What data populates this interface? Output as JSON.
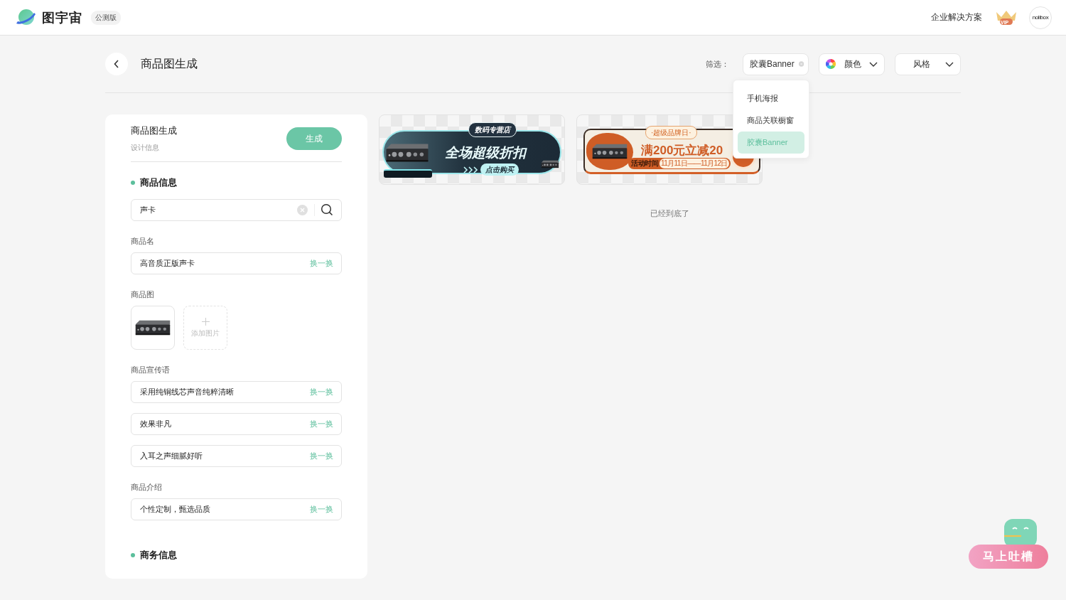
{
  "header": {
    "logo": "图宇宙",
    "badge": "公测版",
    "enterprise_link": "企业解决方案",
    "vip": "VIP",
    "avatar": "nolibox"
  },
  "page": {
    "title": "商品图生成"
  },
  "filters": {
    "label": "筛选：",
    "chips": [
      {
        "kind": "tag",
        "label": "胶囊Banner"
      },
      {
        "kind": "color",
        "label": "颜色"
      },
      {
        "kind": "select",
        "label": "风格"
      }
    ]
  },
  "dropdown": {
    "items": [
      {
        "label": "手机海报",
        "selected": false
      },
      {
        "label": "商品关联橱窗",
        "selected": false
      },
      {
        "label": "胶囊Banner",
        "selected": true
      }
    ]
  },
  "panel": {
    "title": "商品图生成",
    "subtitle": "设计信息",
    "generate_button": "生成",
    "blocks": [
      {
        "kind": "heading",
        "text": "商品信息"
      },
      {
        "kind": "search",
        "value": "声卡"
      },
      {
        "kind": "fields",
        "label": "商品名",
        "fields": [
          {
            "value": "高音质正版声卡",
            "action": "换一换"
          }
        ]
      },
      {
        "kind": "images",
        "label": "商品图",
        "add_label": "添加图片"
      },
      {
        "kind": "fields",
        "label": "商品宣传语",
        "fields": [
          {
            "value": "采用纯铜线芯声音纯粹清晰",
            "action": "换一换"
          },
          {
            "value": "效果非凡",
            "action": "换一换"
          },
          {
            "value": "入耳之声细腻好听",
            "action": "换一换"
          }
        ]
      },
      {
        "kind": "fields",
        "label": "商品介绍",
        "fields": [
          {
            "value": "个性定制，甄选品质",
            "action": "换一换"
          }
        ]
      },
      {
        "kind": "heading",
        "text": "商务信息"
      }
    ]
  },
  "results": [
    {
      "kind": "dark",
      "tag": "数码专营店",
      "headline": "全场超级折扣",
      "button": "点击购买"
    },
    {
      "kind": "warm",
      "tag": "·超级品牌日·",
      "headline": "满200元立减20",
      "date_label": "活动时间",
      "dates": "11月11日——11月12日"
    }
  ],
  "end_text": "已经到底了",
  "feedback": {
    "label": "马上吐槽"
  }
}
